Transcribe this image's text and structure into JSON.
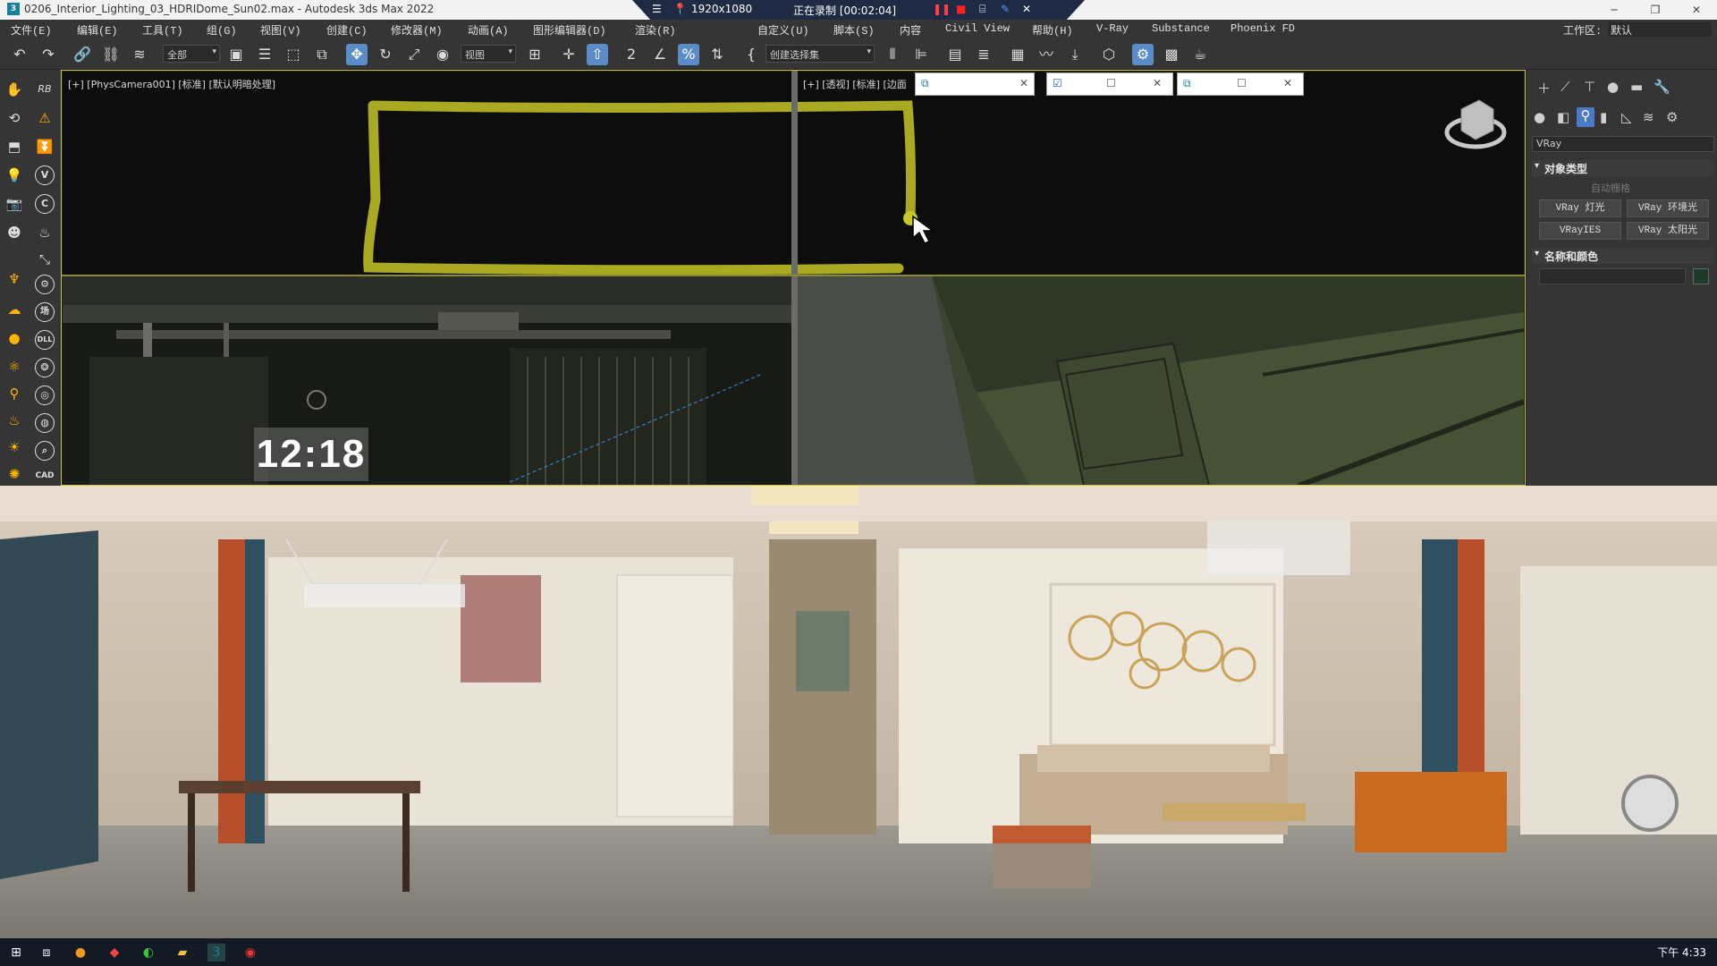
{
  "window": {
    "title": "0206_Interior_Lighting_03_HDRIDome_Sun02.max - Autodesk 3ds Max 2022",
    "minimize": "─",
    "maximize": "❐",
    "close": "✕"
  },
  "recorder": {
    "resolution": "1920x1080",
    "status": "正在录制 [00:02:04]"
  },
  "menu": [
    "文件(E)",
    "编辑(E)",
    "工具(T)",
    "组(G)",
    "视图(V)",
    "创建(C)",
    "修改器(M)",
    "动画(A)",
    "图形编辑器(D)",
    "渲染(R)",
    "自定义(U)",
    "脚本(S)",
    "内容",
    "Civil View",
    "帮助(H)",
    "V-Ray",
    "Substance",
    "Phoenix FD"
  ],
  "workspace": {
    "label": "工作区:",
    "value": "默认"
  },
  "toolbar": {
    "filter": "全部",
    "refcoord": "视图",
    "selset": "创建选择集"
  },
  "left_toolbar": {
    "rb": "RB",
    "v": "V",
    "c": "C",
    "dll": "DLL",
    "field": "场",
    "cad": "CAD"
  },
  "viewports": {
    "camera": "[+] [PhysCamera001] [标准] [默认明暗处理]",
    "persp": "[+] [透视] [标准] [边面"
  },
  "overlay": {
    "time": "12:18"
  },
  "right_panel": {
    "renderer": "VRay",
    "section_object_type": "对象类型",
    "autogrid": "自动栅格",
    "buttons": [
      "VRay 灯光",
      "VRay 环境光",
      "VRayIES",
      "VRay 太阳光"
    ],
    "section_name_color": "名称和颜色"
  },
  "taskbar": {
    "clock": "下午 4:33"
  },
  "colors": {
    "annotation": "#c7c727",
    "viewport_border": "#c8c832",
    "accent": "#4b7bc4"
  }
}
